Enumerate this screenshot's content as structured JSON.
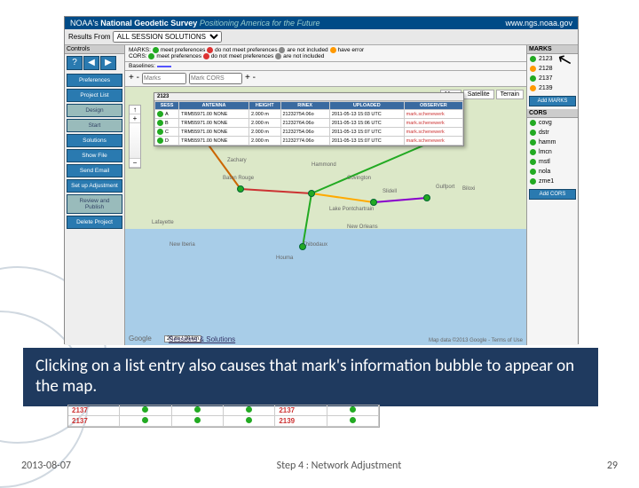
{
  "header": {
    "org": "NOAA's",
    "title": "National Geodetic Survey",
    "slogan": "Positioning America for the Future",
    "url": "www.ngs.noaa.gov"
  },
  "results": {
    "label": "Results From",
    "selected": "ALL SESSION SOLUTIONS"
  },
  "legend": {
    "controls": "Controls",
    "marks_lbl": "MARKS:",
    "cors_lbl": "CORS:",
    "baselines_lbl": "Baselines:",
    "meet": "meet preferences",
    "not_meet": "do not meet preferences",
    "not_incl": "are not included",
    "err": "have error"
  },
  "search": {
    "marks_ph": "Marks",
    "cors_ph": "Mark CORS"
  },
  "sidebar": {
    "prefs": "Preferences",
    "project": "Project List",
    "design": "Design",
    "start": "Start",
    "solutions": "Solutions",
    "show": "Show File",
    "email": "Send Email",
    "setup": "Set up Adjustment",
    "review": "Review and Publish",
    "del": "Delete Project"
  },
  "map": {
    "buttons": {
      "map": "Map",
      "sat": "Satellite",
      "ter": "Terrain"
    },
    "logo": "Google",
    "scale1": "20 mi",
    "scale2": "20 km",
    "copy": "Map data ©2013 Google - Terms of Use",
    "cities": [
      "Baton Rouge",
      "Lafayette",
      "New Iberia",
      "Houma",
      "Thibodaux",
      "New Orleans",
      "Hammond",
      "Lake Pontchartrain",
      "Gulfport",
      "Biloxi",
      "Covington",
      "Slidell",
      "Zachary"
    ]
  },
  "popup": {
    "mark": "2123",
    "cols": [
      "SESS",
      "ANTENNA",
      "HEIGHT",
      "RINEX",
      "UPLOADED",
      "OBSERVER"
    ],
    "rows": [
      [
        "A",
        "TRM55971.00  NONE",
        "2.000 m",
        "21232754.06o",
        "2011-05-13 15:03 UTC",
        "mark.schenewerk"
      ],
      [
        "B",
        "TRM55971.00  NONE",
        "2.000 m",
        "21232764.06o",
        "2011-05-13 15:06 UTC",
        "mark.schenewerk"
      ],
      [
        "C",
        "TRM55971.00  NONE",
        "2.000 m",
        "21232754.06o",
        "2011-05-13 15:07 UTC",
        "mark.schenewerk"
      ],
      [
        "D",
        "TRM55971.00  NONE",
        "2.000 m",
        "21232774.06o",
        "2011-05-13 15:07 UTC",
        "mark.schenewerk"
      ]
    ]
  },
  "right": {
    "marks_h": "MARKS",
    "marks": [
      {
        "id": "2123",
        "c": "#2a2"
      },
      {
        "id": "2128",
        "c": "#f90"
      },
      {
        "id": "2137",
        "c": "#2a2"
      },
      {
        "id": "2139",
        "c": "#f90"
      }
    ],
    "add_marks": "Add MARKS",
    "cors_h": "CORS",
    "cors": [
      "covg",
      "dstr",
      "hamm",
      "lmcn",
      "mstl",
      "nola",
      "zme1"
    ],
    "add_cors": "Add CORS"
  },
  "sessions_h": "Sessions & Solutions",
  "callout": "Clicking on a list entry also causes that mark's information bubble to appear on the map.",
  "below": {
    "r1a": "2137",
    "r1b": "2137",
    "r2a": "2137",
    "r2b": "2139"
  },
  "footer": {
    "date": "2013-08-07",
    "step": "Step 4 : Network Adjustment",
    "page": "29"
  }
}
